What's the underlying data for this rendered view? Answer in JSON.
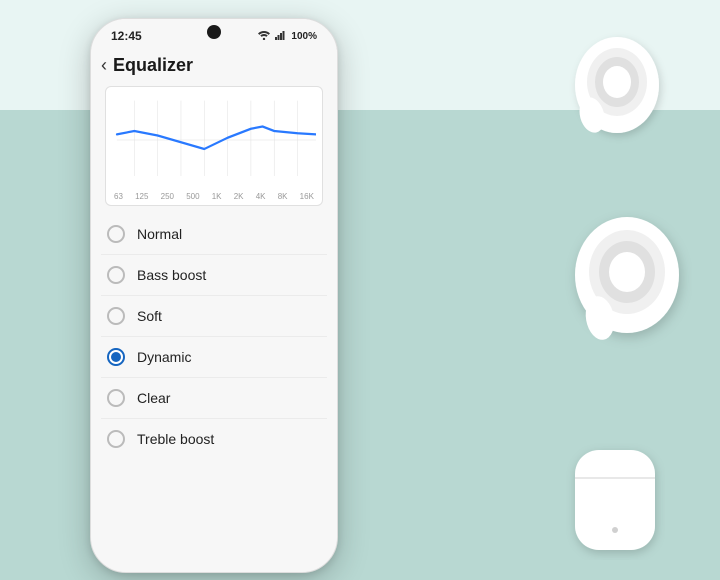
{
  "app": {
    "title": "Equalizer",
    "back_label": "‹"
  },
  "status_bar": {
    "time": "12:45",
    "wifi": "WiFi",
    "signal": "Signal",
    "battery": "100%"
  },
  "eq_chart": {
    "labels": [
      "63",
      "125",
      "250",
      "500",
      "1K",
      "2K",
      "4K",
      "8K",
      "16K"
    ]
  },
  "eq_options": [
    {
      "id": "normal",
      "label": "Normal",
      "selected": false
    },
    {
      "id": "bass-boost",
      "label": "Bass boost",
      "selected": false
    },
    {
      "id": "soft",
      "label": "Soft",
      "selected": false
    },
    {
      "id": "dynamic",
      "label": "Dynamic",
      "selected": true
    },
    {
      "id": "clear",
      "label": "Clear",
      "selected": false
    },
    {
      "id": "treble-boost",
      "label": "Treble boost",
      "selected": false
    }
  ],
  "colors": {
    "accent": "#1565c0",
    "bg_light": "#e8f5f3",
    "bg_teal": "#b8d8d2"
  }
}
